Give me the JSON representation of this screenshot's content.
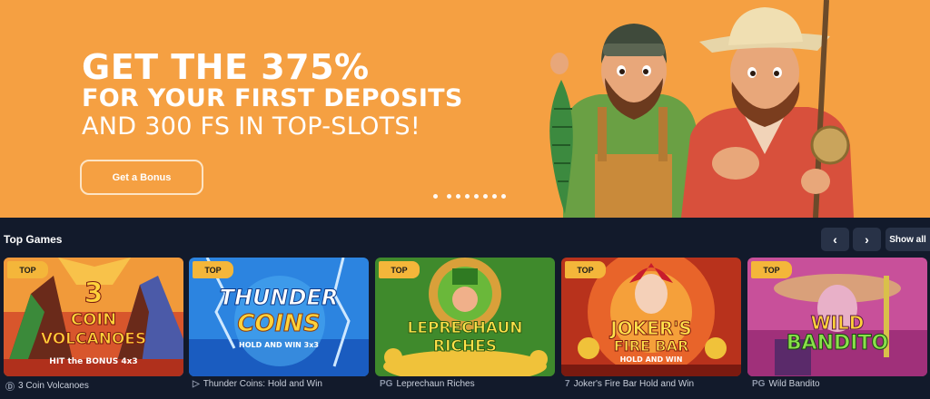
{
  "hero": {
    "headline": "GET THE 375%",
    "line2": "FOR YOUR FIRST DEPOSITS",
    "line3": "AND 300 FS IN TOP-SLOTS!",
    "cta_label": "Get a Bonus",
    "bg_color": "#f5a042"
  },
  "top_games": {
    "title": "Top Games",
    "prev_icon": "‹",
    "next_icon": "›",
    "show_all_label": "Show all",
    "badge": "TOP",
    "games": [
      {
        "name": "3 Coin Volcanoes",
        "provider_icon": "Ⓓ",
        "art_line1": "3",
        "art_line2": "COIN",
        "art_line3": "VOLCANOES",
        "art_sub": "HIT the BONUS 4x3"
      },
      {
        "name": "Thunder Coins: Hold and Win",
        "provider_icon": "▷",
        "art_line1": "THUNDER",
        "art_line2": "COINS",
        "art_sub": "HOLD AND WIN 3x3"
      },
      {
        "name": "Leprechaun Riches",
        "provider_icon": "PG",
        "art_line1": "LEPRECHAUN",
        "art_line2": "RICHES"
      },
      {
        "name": "Joker's Fire Bar Hold and Win",
        "provider_icon": "7",
        "art_line1": "JOKER'S",
        "art_line2": "FIRE BAR",
        "art_sub": "HOLD AND WIN"
      },
      {
        "name": "Wild Bandito",
        "provider_icon": "PG",
        "art_line1": "WILD",
        "art_line2": "BANDITO"
      }
    ]
  }
}
